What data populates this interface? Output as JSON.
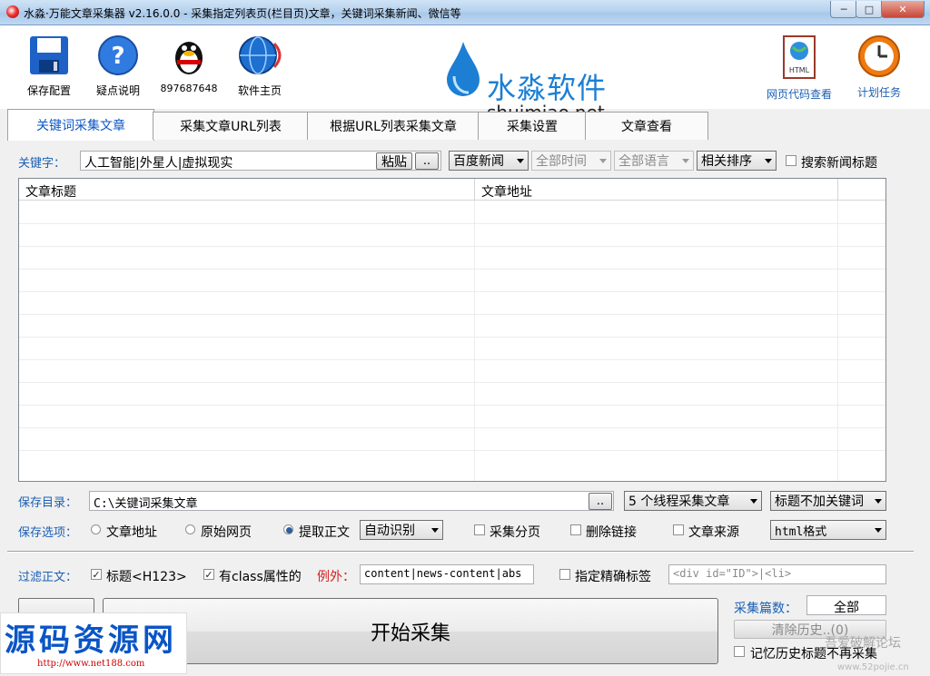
{
  "window": {
    "title": "水淼·万能文章采集器 v2.16.0.0 - 采集指定列表页(栏目页)文章，关键词采集新闻、微信等",
    "minimize": "─",
    "maximize": "□",
    "close": "✕"
  },
  "toolbar": {
    "save_config": "保存配置",
    "help": "疑点说明",
    "qq": "897687648",
    "homepage": "软件主页",
    "brand_cn": "水淼软件",
    "brand_en": "shuimiao.net",
    "html_view": "网页代码查看",
    "schedule": "计划任务",
    "html_icon_text": "HTML"
  },
  "tabs": [
    "关键词采集文章",
    "采集文章URL列表",
    "根据URL列表采集文章",
    "采集设置",
    "文章查看"
  ],
  "keyword": {
    "label": "关键字：",
    "value": "人工智能|外星人|虚拟现实",
    "paste": "粘贴",
    "dots": "..",
    "source": "百度新闻",
    "time": "全部时间",
    "language": "全部语言",
    "sort": "相关排序",
    "search_title": "搜索新闻标题"
  },
  "grid": {
    "columns": [
      "文章标题",
      "文章地址"
    ]
  },
  "save": {
    "dir_label": "保存目录：",
    "dir_value": "C:\\关键词采集文章",
    "dots": "..",
    "threads": "5 个线程采集文章",
    "title_kw": "标题不加关键词",
    "options_label": "保存选项：",
    "opt_url": "文章地址",
    "opt_raw": "原始网页",
    "opt_extract": "提取正文",
    "auto_detect": "自动识别",
    "paging": "采集分页",
    "del_links": "删除链接",
    "source": "文章来源",
    "format": "html格式"
  },
  "filter": {
    "label": "过滤正文：",
    "title_tags": "标题<H123>",
    "class_attr": "有class属性的",
    "exception": "例外：",
    "exception_value": "content|news-content|abs",
    "precise_tag": "指定精确标签",
    "precise_placeholder": "<div id=\"ID\">|<li>"
  },
  "bottom": {
    "start": "开始采集",
    "count_label": "采集篇数：",
    "count_value": "全部",
    "clear_history": "清除历史..(0)",
    "remember": "记忆历史标题不再采集"
  },
  "watermark": {
    "big": "源码资源网",
    "url": "http://www.net188.com",
    "corner": "吾爱破解论坛",
    "corner_url": "www.52pojie.cn"
  }
}
